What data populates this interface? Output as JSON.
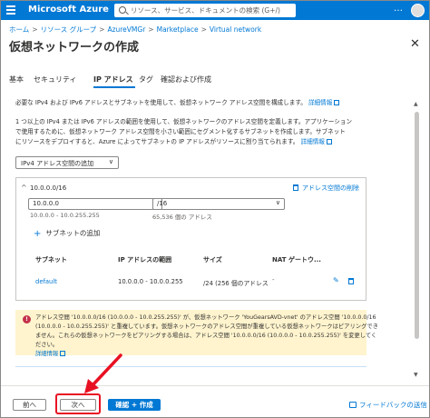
{
  "topbar": {
    "brand": "Microsoft Azure",
    "search_placeholder": "リソース、サービス、ドキュメントの検索 (G+/)",
    "more": "…",
    "colors": {
      "accent": "#0078d4"
    }
  },
  "breadcrumb": [
    "ホーム",
    "リソース グループ",
    "AzureVMGr",
    "Marketplace",
    "Virtual network"
  ],
  "breadcrumb_sep": ">",
  "page": {
    "title": "仮想ネットワークの作成",
    "more": "…",
    "close": "✕"
  },
  "tabs": [
    {
      "label": "基本"
    },
    {
      "label": "セキュリティ"
    },
    {
      "label": "IP アドレス",
      "active": true
    },
    {
      "label": "タグ"
    },
    {
      "label": "確認および作成"
    }
  ],
  "intro": {
    "line1": "必要な IPv4 および IPv6 アドレスとサブネットを使用して、仮想ネットワーク アドレス空間を構成します。",
    "line1_link": "詳細情報",
    "line2": "1 つ以上の IPv4 または IPv6 アドレスの範囲を使用して、仮想ネットワークのアドレス空間を定義します。アプリケーション",
    "line3": "で使用するために、仮想ネットワーク アドレス空間を小さい範囲にセグメント化するサブネットを作成します。サブネット",
    "line4": "にリソースをデプロイすると、Azure によってサブネットの IP アドレスがリソースに割り当てられます。",
    "line4_link": "詳細情報"
  },
  "add_address_space": {
    "label": "IPv4 アドレス空間の追加",
    "chevron": "∨"
  },
  "address_space": {
    "cidr": "10.0.0.0/16",
    "delete_label": "アドレス空間の削除",
    "ip_value": "10.0.0.0",
    "prefix_value": "/16",
    "range_hint": "10.0.0.0 - 10.0.255.255",
    "count_hint": "65,536 個の アドレス",
    "add_subnet_label": "サブネットの追加",
    "columns": [
      "サブネット",
      "IP アドレスの範囲",
      "サイズ",
      "NAT ゲートウ..."
    ],
    "rows": [
      {
        "subnet": "default",
        "range": "10.0.0.0 - 10.0.0.255",
        "size": "/24 (256 個のアドレス",
        "nat": "-",
        "more": "…"
      }
    ]
  },
  "warning": {
    "icon": "!",
    "line1": "アドレス空間 '10.0.0.0/16 (10.0.0.0 - 10.0.255.255)' が、仮想ネットワーク 'YouGearsAVD-vnet' のアドレス空間 '10.0.0.0/16",
    "line2": "(10.0.0.0 - 10.0.255.255)' と重複しています。仮想ネットワークのアドレス空間が重複している仮想ネットワークはピアリングでき",
    "line3": "ません。これらの仮想ネットワークをピアリングする場合は、アドレス空間 '10.0.0.0/16 (10.0.0.0 - 10.0.255.255)' を変更してく",
    "line4": "ださい。",
    "link": "詳細情報"
  },
  "footer": {
    "prev": "前へ",
    "next": "次へ",
    "create": "確認 + 作成",
    "feedback": "フィードバックの送信"
  },
  "annotation": {
    "highlight_color": "#e81123"
  }
}
